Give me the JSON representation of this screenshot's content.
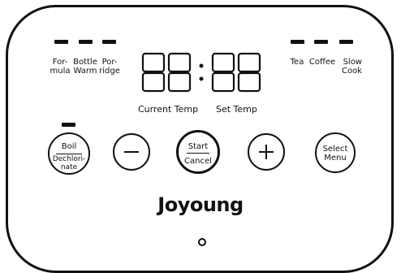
{
  "left_modes": {
    "formula": "For-\nmula",
    "bottle_warm": "Bottle\nWarm",
    "porridge": "Por-\nridge"
  },
  "right_modes": {
    "tea": "Tea",
    "coffee": "Coffee",
    "slow_cook": "Slow\nCook"
  },
  "display": {
    "digits": "88:88",
    "current_temp_label": "Current Temp",
    "set_temp_label": "Set Temp"
  },
  "buttons": {
    "boil_label": "Boil",
    "dechlorinate_label": "Dechlori-\nnate",
    "minus_label": "—",
    "start_label": "Start",
    "cancel_label": "Cancel",
    "plus_label": "+",
    "select_menu_label": "Select\nMenu"
  },
  "brand": "Joyoung"
}
